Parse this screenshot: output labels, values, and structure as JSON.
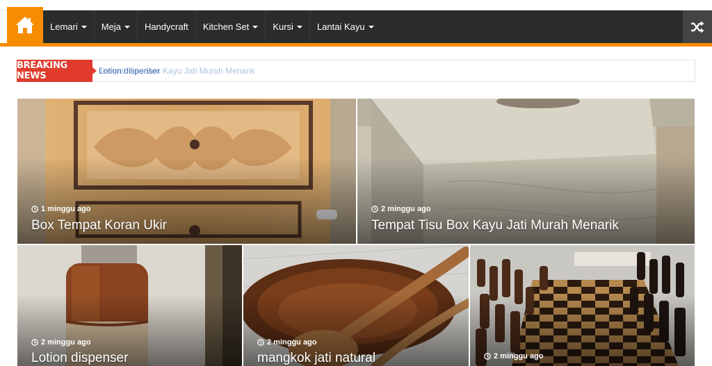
{
  "nav": {
    "menu": [
      {
        "label": "Lemari",
        "has_dropdown": true
      },
      {
        "label": "Meja",
        "has_dropdown": true
      },
      {
        "label": "Handycraft",
        "has_dropdown": false
      },
      {
        "label": "Kitchen Set",
        "has_dropdown": true
      },
      {
        "label": "Kursi",
        "has_dropdown": true
      },
      {
        "label": "Lantai Kayu",
        "has_dropdown": true
      }
    ],
    "home_icon": "home-icon",
    "shuffle_icon": "shuffle-icon"
  },
  "breaking": {
    "label": "Breaking News",
    "ticker_current": "Lotion dispenser",
    "ticker_fading": "Tempat Tisu Box Kayu Jati Murah Menarik"
  },
  "posts": [
    {
      "date": "1 minggu ago",
      "title": "Box Tempat Koran Ukir"
    },
    {
      "date": "2 minggu ago",
      "title": "Tempat Tisu Box Kayu Jati Murah Menarik"
    },
    {
      "date": "2 minggu ago",
      "title": "Lotion dispenser"
    },
    {
      "date": "2 minggu ago",
      "title": "mangkok jati natural"
    },
    {
      "date": "2 minggu ago",
      "title": ""
    }
  ],
  "colors": {
    "accent": "#f88c00",
    "nav_bg": "#2b2b2b",
    "breaking_red": "#e03b2c"
  }
}
